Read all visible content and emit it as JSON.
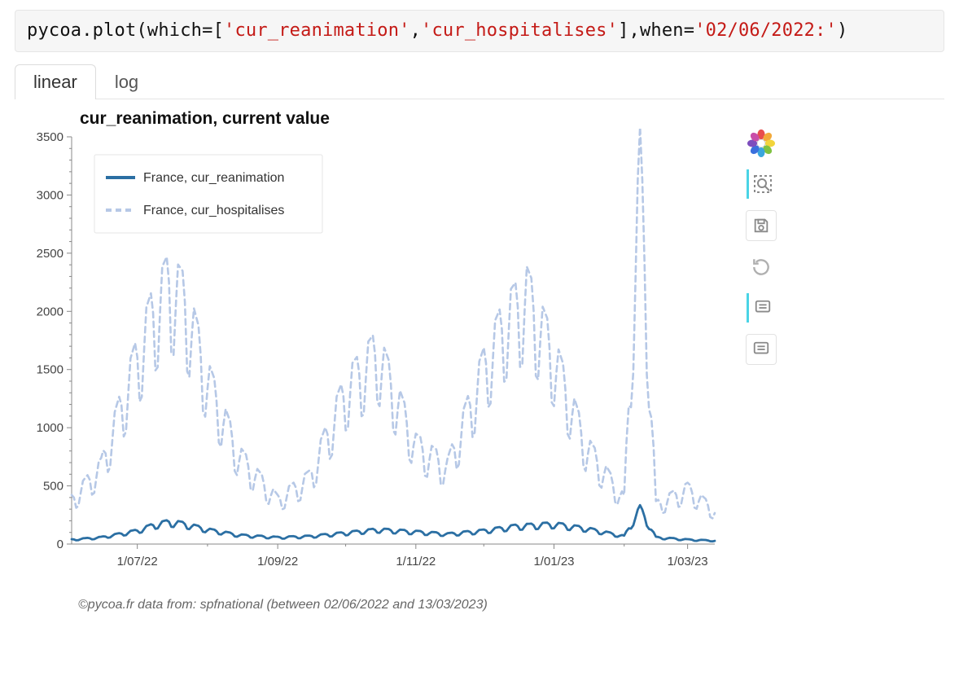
{
  "code": {
    "prefix": "pycoa.plot(which=[",
    "str1": "'cur_reanimation'",
    "comma": ",",
    "str2": "'cur_hospitalises'",
    "midsuffix": "],when=",
    "str3": "'02/06/2022:'",
    "endsuffix": ")"
  },
  "tabs": {
    "linear": "linear",
    "log": "log",
    "active": "linear"
  },
  "chart": {
    "title": "cur_reanimation, current value",
    "legend": {
      "series1": "France, cur_reanimation",
      "series2": "France, cur_hospitalises"
    },
    "yticks": {
      "0": "0",
      "500": "500",
      "1000": "1000",
      "1500": "1500",
      "2000": "2000",
      "2500": "2500",
      "3000": "3000",
      "3500": "3500"
    },
    "xticks": {
      "t0": "1/07/22",
      "t1": "1/09/22",
      "t2": "1/11/22",
      "t3": "1/01/23",
      "t4": "1/03/23"
    }
  },
  "caption": "©pycoa.fr data from: spfnational  (between 02/06/2022 and 13/03/2023)",
  "toolbar": {
    "logo": "bokeh-logo",
    "zoom": "box-zoom-icon",
    "save": "save-icon",
    "reset": "reset-icon",
    "hover1": "hover-icon",
    "hover2": "hover-icon"
  },
  "chart_data": {
    "type": "line",
    "title": "cur_reanimation, current value",
    "xlabel": "",
    "ylabel": "",
    "ylim": [
      0,
      3500
    ],
    "x_range": [
      "2022-06-02",
      "2023-03-13"
    ],
    "x_ticks": [
      "1/07/22",
      "1/09/22",
      "1/11/22",
      "1/01/23",
      "1/03/23"
    ],
    "caption": "©pycoa.fr data from: spfnational  (between 02/06/2022 and 13/03/2023)",
    "series": [
      {
        "name": "France, cur_reanimation",
        "style": "solid",
        "color": "#2b6fa3",
        "x": [
          "2022-06-02",
          "2022-06-15",
          "2022-07-01",
          "2022-07-08",
          "2022-07-15",
          "2022-07-22",
          "2022-08-01",
          "2022-08-15",
          "2022-09-01",
          "2022-09-15",
          "2022-10-01",
          "2022-10-15",
          "2022-11-01",
          "2022-11-15",
          "2022-12-01",
          "2022-12-15",
          "2023-01-01",
          "2023-01-15",
          "2023-02-01",
          "2023-02-08",
          "2023-02-15",
          "2023-03-01",
          "2023-03-13"
        ],
        "values": [
          40,
          60,
          120,
          170,
          200,
          180,
          130,
          80,
          60,
          70,
          100,
          130,
          110,
          90,
          120,
          160,
          180,
          140,
          70,
          320,
          60,
          40,
          30
        ]
      },
      {
        "name": "France, cur_hospitalises",
        "style": "dashed",
        "color": "#b6c8e6",
        "x": [
          "2022-06-02",
          "2022-06-15",
          "2022-07-01",
          "2022-07-08",
          "2022-07-15",
          "2022-07-22",
          "2022-08-01",
          "2022-08-15",
          "2022-09-01",
          "2022-09-15",
          "2022-10-01",
          "2022-10-15",
          "2022-11-01",
          "2022-11-15",
          "2022-12-01",
          "2022-12-10",
          "2022-12-20",
          "2023-01-01",
          "2023-01-15",
          "2023-02-01",
          "2023-02-08",
          "2023-02-15",
          "2023-03-01",
          "2023-03-13"
        ],
        "values": [
          400,
          700,
          1700,
          2100,
          2380,
          2200,
          1500,
          800,
          400,
          600,
          1400,
          1750,
          900,
          700,
          1600,
          2000,
          2260,
          1700,
          900,
          400,
          3400,
          350,
          500,
          300
        ]
      }
    ]
  }
}
